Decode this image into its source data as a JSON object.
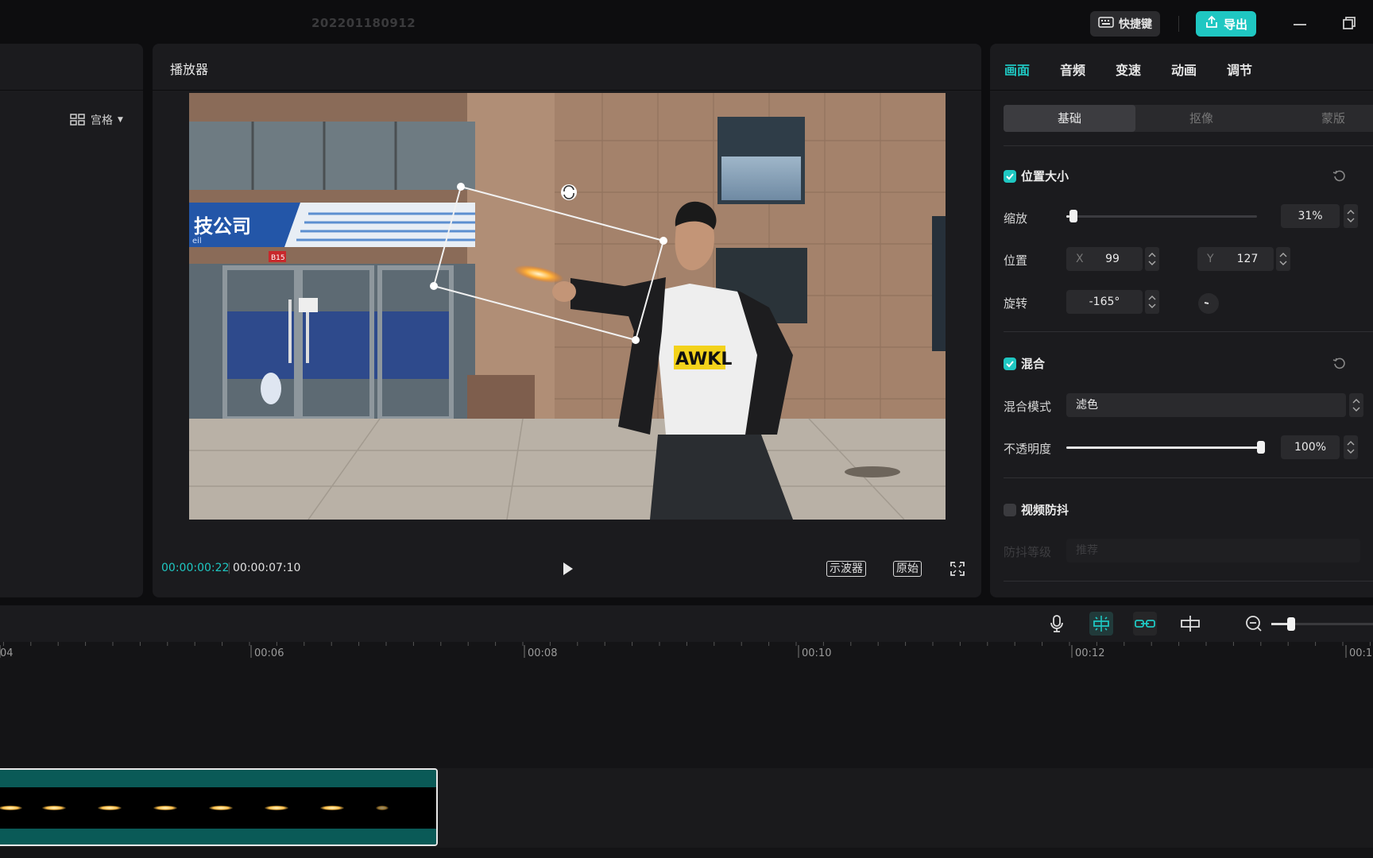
{
  "app": {
    "project_title": "202201180912",
    "shortcut_label": "快捷键",
    "export_label": "导出"
  },
  "left_panel": {
    "layout_toggle_label": "宫格"
  },
  "player": {
    "title": "播放器",
    "time_current": "00:00:00:22",
    "time_separator": "|",
    "time_total": "00:00:07:10",
    "scope_label": "示波器",
    "ratio_label": "原始",
    "video_sign_text": "技公司",
    "video_sign_sub": "eil",
    "video_plate": "B15",
    "shirt_text": "AWKL"
  },
  "inspector": {
    "tabs": [
      "画面",
      "音频",
      "变速",
      "动画",
      "调节"
    ],
    "active_tab": "画面",
    "sub_tabs": [
      "基础",
      "抠像",
      "蒙版"
    ],
    "position_size": {
      "title": "位置大小",
      "enabled": true,
      "scale_label": "缩放",
      "scale_value": "31%",
      "scale_fraction": 0.31,
      "position_label": "位置",
      "x_label": "X",
      "x_value": "99",
      "y_label": "Y",
      "y_value": "127",
      "rotate_label": "旋转",
      "rotate_value": "-165°"
    },
    "blend": {
      "title": "混合",
      "enabled": true,
      "mode_label": "混合模式",
      "mode_value": "滤色",
      "opacity_label": "不透明度",
      "opacity_value": "100%",
      "opacity_fraction": 1.0
    },
    "stabilize": {
      "title": "视频防抖",
      "enabled": false,
      "level_label": "防抖等级",
      "level_value": "推荐"
    }
  },
  "timeline": {
    "ruler_labels": [
      "04",
      "00:06",
      "00:08",
      "00:10",
      "00:12",
      "00:1"
    ]
  },
  "colors": {
    "accent": "#1fc7c2",
    "panel": "#1b1b1e",
    "background": "#0d0d0f",
    "clip_band": "#0a5a57"
  }
}
